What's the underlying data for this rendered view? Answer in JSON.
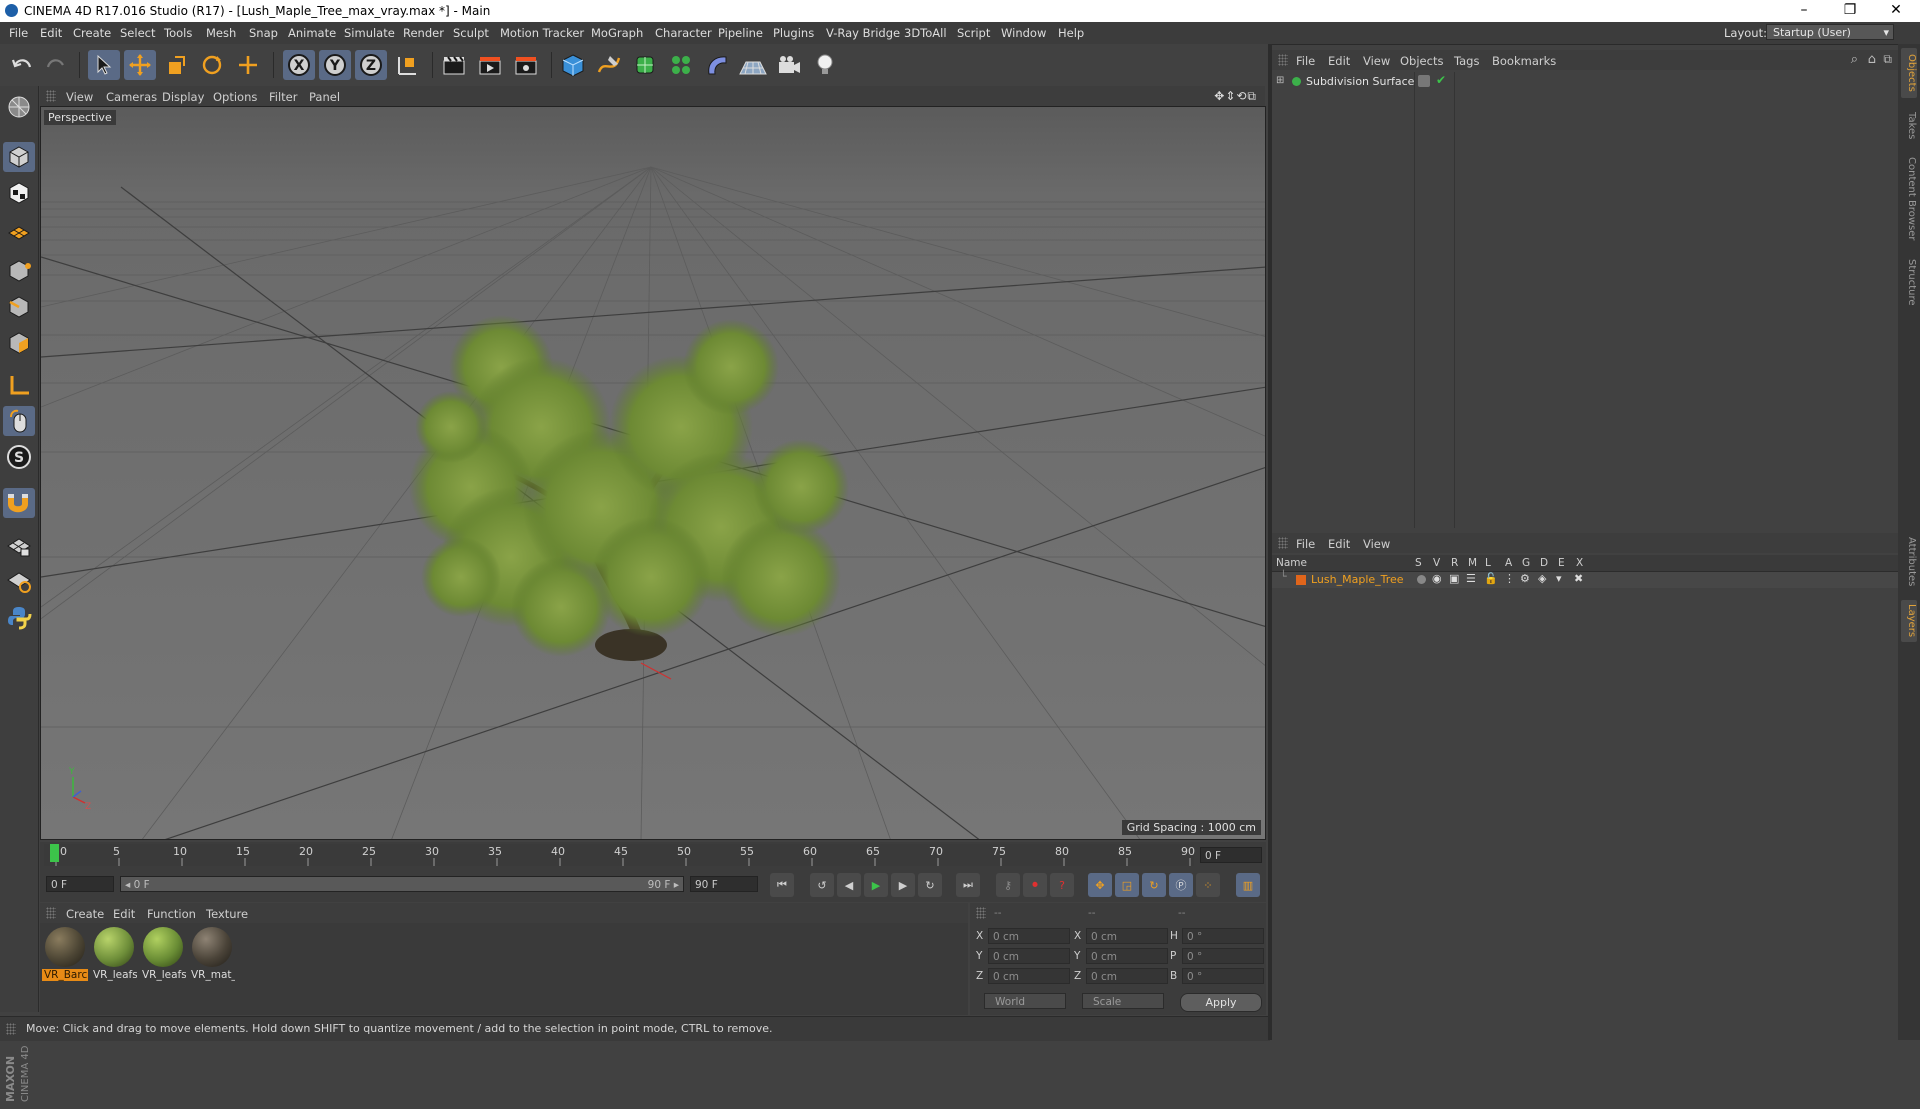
{
  "window": {
    "title": "CINEMA 4D R17.016 Studio (R17) - [Lush_Maple_Tree_max_vray.max *] - Main",
    "minimize": "–",
    "maximize": "❐",
    "close": "✕"
  },
  "menubar": {
    "items": [
      "File",
      "Edit",
      "Create",
      "Select",
      "Tools",
      "Mesh",
      "Snap",
      "Animate",
      "Simulate",
      "Render",
      "Sculpt",
      "Motion Tracker",
      "MoGraph",
      "Character",
      "Pipeline",
      "Plugins",
      "V-Ray Bridge",
      "3DToAll",
      "Script",
      "Window",
      "Help"
    ],
    "layout_label": "Layout:",
    "layout_value": "Startup (User)"
  },
  "viewport": {
    "menu": [
      "View",
      "Cameras",
      "Display",
      "Options",
      "Filter",
      "Panel"
    ],
    "nav_icons": "✥⇕⟲⧉",
    "camera_label": "Perspective",
    "grid_spacing": "Grid Spacing : 1000 cm",
    "axis_y": "Y",
    "axis_z": "Z"
  },
  "timeline": {
    "ticks": [
      "0",
      "5",
      "10",
      "15",
      "20",
      "25",
      "30",
      "35",
      "40",
      "45",
      "50",
      "55",
      "60",
      "65",
      "70",
      "75",
      "80",
      "85",
      "90"
    ],
    "current_frame_field": "0 F",
    "start_field": "0 F",
    "range_start": "◂ 0 F",
    "range_end": "90 F ▸",
    "end_field": "90 F"
  },
  "materials": {
    "menu": [
      "Create",
      "Edit",
      "Function",
      "Texture"
    ],
    "items": [
      {
        "label": "VR_Barc",
        "selected": true,
        "color": "#4c4534"
      },
      {
        "label": "VR_leafs",
        "selected": false,
        "color": "#6f8f3a"
      },
      {
        "label": "VR_leafs",
        "selected": false,
        "color": "#6a8d35"
      },
      {
        "label": "VR_mat_",
        "selected": false,
        "color": "#4a4338"
      }
    ]
  },
  "coordinates": {
    "header": [
      "--",
      "--",
      "--"
    ],
    "rows": [
      {
        "a": "X",
        "av": "0 cm",
        "b": "X",
        "bv": "0 cm",
        "c": "H",
        "cv": "0 °"
      },
      {
        "a": "Y",
        "av": "0 cm",
        "b": "Y",
        "bv": "0 cm",
        "c": "P",
        "cv": "0 °"
      },
      {
        "a": "Z",
        "av": "0 cm",
        "b": "Z",
        "bv": "0 cm",
        "c": "B",
        "cv": "0 °"
      }
    ],
    "mode_world": "World",
    "mode_scale": "Scale",
    "apply": "Apply"
  },
  "objects": {
    "menu": [
      "File",
      "Edit",
      "View",
      "Objects",
      "Tags",
      "Bookmarks"
    ],
    "items": [
      {
        "name": "Subdivision Surface"
      }
    ]
  },
  "layers": {
    "menu": [
      "File",
      "Edit",
      "View"
    ],
    "columns": [
      "Name",
      "S",
      "V",
      "R",
      "M",
      "L",
      "A",
      "G",
      "D",
      "E",
      "X"
    ],
    "items": [
      {
        "name": "Lush_Maple_Tree",
        "color": "#e0651b"
      }
    ]
  },
  "side_tabs": [
    "Objects",
    "Takes",
    "Content Browser",
    "Structure",
    "Attributes",
    "Layers"
  ],
  "status": {
    "text": "Move: Click and drag to move elements. Hold down SHIFT to quantize movement / add to the selection in point mode, CTRL to remove."
  },
  "brand": {
    "line1": "MAXON",
    "line2": "CINEMA 4D"
  },
  "colors": {
    "accent": "#e88b16",
    "active_tool": "#5a6a86",
    "panel": "#414141"
  }
}
